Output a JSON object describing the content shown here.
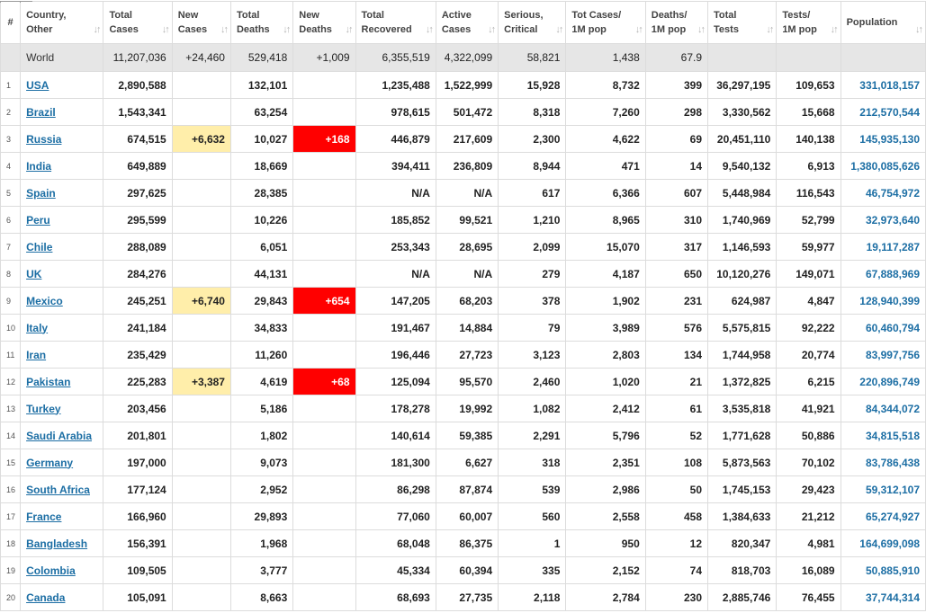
{
  "headers": [
    {
      "label": "#",
      "sort": false
    },
    {
      "label": "Country,\nOther",
      "sort": true
    },
    {
      "label": "Total\nCases",
      "sort": true
    },
    {
      "label": "New\nCases",
      "sort": true
    },
    {
      "label": "Total\nDeaths",
      "sort": true
    },
    {
      "label": "New\nDeaths",
      "sort": true
    },
    {
      "label": "Total\nRecovered",
      "sort": true
    },
    {
      "label": "Active\nCases",
      "sort": true
    },
    {
      "label": "Serious,\nCritical",
      "sort": true
    },
    {
      "label": "Tot Cases/\n1M pop",
      "sort": true
    },
    {
      "label": "Deaths/\n1M pop",
      "sort": true
    },
    {
      "label": "Total\nTests",
      "sort": true
    },
    {
      "label": "Tests/\n1M pop",
      "sort": true
    },
    {
      "label": "Population",
      "sort": true
    }
  ],
  "sort_icon": "↓↑",
  "sort_icon_active": "↓↑",
  "world": {
    "country": "World",
    "total_cases": "11,207,036",
    "new_cases": "+24,460",
    "total_deaths": "529,418",
    "new_deaths": "+1,009",
    "total_recovered": "6,355,519",
    "active_cases": "4,322,099",
    "serious": "58,821",
    "cases_1m": "1,438",
    "deaths_1m": "67.9",
    "total_tests": "",
    "tests_1m": "",
    "population": ""
  },
  "rows": [
    {
      "idx": "1",
      "country": "USA",
      "total_cases": "2,890,588",
      "new_cases": "",
      "total_deaths": "132,101",
      "new_deaths": "",
      "total_recovered": "1,235,488",
      "active_cases": "1,522,999",
      "serious": "15,928",
      "cases_1m": "8,732",
      "deaths_1m": "399",
      "total_tests": "36,297,195",
      "tests_1m": "109,653",
      "population": "331,018,157"
    },
    {
      "idx": "2",
      "country": "Brazil",
      "total_cases": "1,543,341",
      "new_cases": "",
      "total_deaths": "63,254",
      "new_deaths": "",
      "total_recovered": "978,615",
      "active_cases": "501,472",
      "serious": "8,318",
      "cases_1m": "7,260",
      "deaths_1m": "298",
      "total_tests": "3,330,562",
      "tests_1m": "15,668",
      "population": "212,570,544"
    },
    {
      "idx": "3",
      "country": "Russia",
      "total_cases": "674,515",
      "new_cases": "+6,632",
      "total_deaths": "10,027",
      "new_deaths": "+168",
      "total_recovered": "446,879",
      "active_cases": "217,609",
      "serious": "2,300",
      "cases_1m": "4,622",
      "deaths_1m": "69",
      "total_tests": "20,451,110",
      "tests_1m": "140,138",
      "population": "145,935,130"
    },
    {
      "idx": "4",
      "country": "India",
      "total_cases": "649,889",
      "new_cases": "",
      "total_deaths": "18,669",
      "new_deaths": "",
      "total_recovered": "394,411",
      "active_cases": "236,809",
      "serious": "8,944",
      "cases_1m": "471",
      "deaths_1m": "14",
      "total_tests": "9,540,132",
      "tests_1m": "6,913",
      "population": "1,380,085,626"
    },
    {
      "idx": "5",
      "country": "Spain",
      "total_cases": "297,625",
      "new_cases": "",
      "total_deaths": "28,385",
      "new_deaths": "",
      "total_recovered": "N/A",
      "active_cases": "N/A",
      "serious": "617",
      "cases_1m": "6,366",
      "deaths_1m": "607",
      "total_tests": "5,448,984",
      "tests_1m": "116,543",
      "population": "46,754,972"
    },
    {
      "idx": "6",
      "country": "Peru",
      "total_cases": "295,599",
      "new_cases": "",
      "total_deaths": "10,226",
      "new_deaths": "",
      "total_recovered": "185,852",
      "active_cases": "99,521",
      "serious": "1,210",
      "cases_1m": "8,965",
      "deaths_1m": "310",
      "total_tests": "1,740,969",
      "tests_1m": "52,799",
      "population": "32,973,640"
    },
    {
      "idx": "7",
      "country": "Chile",
      "total_cases": "288,089",
      "new_cases": "",
      "total_deaths": "6,051",
      "new_deaths": "",
      "total_recovered": "253,343",
      "active_cases": "28,695",
      "serious": "2,099",
      "cases_1m": "15,070",
      "deaths_1m": "317",
      "total_tests": "1,146,593",
      "tests_1m": "59,977",
      "population": "19,117,287"
    },
    {
      "idx": "8",
      "country": "UK",
      "total_cases": "284,276",
      "new_cases": "",
      "total_deaths": "44,131",
      "new_deaths": "",
      "total_recovered": "N/A",
      "active_cases": "N/A",
      "serious": "279",
      "cases_1m": "4,187",
      "deaths_1m": "650",
      "total_tests": "10,120,276",
      "tests_1m": "149,071",
      "population": "67,888,969"
    },
    {
      "idx": "9",
      "country": "Mexico",
      "total_cases": "245,251",
      "new_cases": "+6,740",
      "total_deaths": "29,843",
      "new_deaths": "+654",
      "total_recovered": "147,205",
      "active_cases": "68,203",
      "serious": "378",
      "cases_1m": "1,902",
      "deaths_1m": "231",
      "total_tests": "624,987",
      "tests_1m": "4,847",
      "population": "128,940,399"
    },
    {
      "idx": "10",
      "country": "Italy",
      "total_cases": "241,184",
      "new_cases": "",
      "total_deaths": "34,833",
      "new_deaths": "",
      "total_recovered": "191,467",
      "active_cases": "14,884",
      "serious": "79",
      "cases_1m": "3,989",
      "deaths_1m": "576",
      "total_tests": "5,575,815",
      "tests_1m": "92,222",
      "population": "60,460,794"
    },
    {
      "idx": "11",
      "country": "Iran",
      "total_cases": "235,429",
      "new_cases": "",
      "total_deaths": "11,260",
      "new_deaths": "",
      "total_recovered": "196,446",
      "active_cases": "27,723",
      "serious": "3,123",
      "cases_1m": "2,803",
      "deaths_1m": "134",
      "total_tests": "1,744,958",
      "tests_1m": "20,774",
      "population": "83,997,756"
    },
    {
      "idx": "12",
      "country": "Pakistan",
      "total_cases": "225,283",
      "new_cases": "+3,387",
      "total_deaths": "4,619",
      "new_deaths": "+68",
      "total_recovered": "125,094",
      "active_cases": "95,570",
      "serious": "2,460",
      "cases_1m": "1,020",
      "deaths_1m": "21",
      "total_tests": "1,372,825",
      "tests_1m": "6,215",
      "population": "220,896,749"
    },
    {
      "idx": "13",
      "country": "Turkey",
      "total_cases": "203,456",
      "new_cases": "",
      "total_deaths": "5,186",
      "new_deaths": "",
      "total_recovered": "178,278",
      "active_cases": "19,992",
      "serious": "1,082",
      "cases_1m": "2,412",
      "deaths_1m": "61",
      "total_tests": "3,535,818",
      "tests_1m": "41,921",
      "population": "84,344,072"
    },
    {
      "idx": "14",
      "country": "Saudi Arabia",
      "total_cases": "201,801",
      "new_cases": "",
      "total_deaths": "1,802",
      "new_deaths": "",
      "total_recovered": "140,614",
      "active_cases": "59,385",
      "serious": "2,291",
      "cases_1m": "5,796",
      "deaths_1m": "52",
      "total_tests": "1,771,628",
      "tests_1m": "50,886",
      "population": "34,815,518"
    },
    {
      "idx": "15",
      "country": "Germany",
      "total_cases": "197,000",
      "new_cases": "",
      "total_deaths": "9,073",
      "new_deaths": "",
      "total_recovered": "181,300",
      "active_cases": "6,627",
      "serious": "318",
      "cases_1m": "2,351",
      "deaths_1m": "108",
      "total_tests": "5,873,563",
      "tests_1m": "70,102",
      "population": "83,786,438"
    },
    {
      "idx": "16",
      "country": "South Africa",
      "total_cases": "177,124",
      "new_cases": "",
      "total_deaths": "2,952",
      "new_deaths": "",
      "total_recovered": "86,298",
      "active_cases": "87,874",
      "serious": "539",
      "cases_1m": "2,986",
      "deaths_1m": "50",
      "total_tests": "1,745,153",
      "tests_1m": "29,423",
      "population": "59,312,107"
    },
    {
      "idx": "17",
      "country": "France",
      "total_cases": "166,960",
      "new_cases": "",
      "total_deaths": "29,893",
      "new_deaths": "",
      "total_recovered": "77,060",
      "active_cases": "60,007",
      "serious": "560",
      "cases_1m": "2,558",
      "deaths_1m": "458",
      "total_tests": "1,384,633",
      "tests_1m": "21,212",
      "population": "65,274,927"
    },
    {
      "idx": "18",
      "country": "Bangladesh",
      "total_cases": "156,391",
      "new_cases": "",
      "total_deaths": "1,968",
      "new_deaths": "",
      "total_recovered": "68,048",
      "active_cases": "86,375",
      "serious": "1",
      "cases_1m": "950",
      "deaths_1m": "12",
      "total_tests": "820,347",
      "tests_1m": "4,981",
      "population": "164,699,098"
    },
    {
      "idx": "19",
      "country": "Colombia",
      "total_cases": "109,505",
      "new_cases": "",
      "total_deaths": "3,777",
      "new_deaths": "",
      "total_recovered": "45,334",
      "active_cases": "60,394",
      "serious": "335",
      "cases_1m": "2,152",
      "deaths_1m": "74",
      "total_tests": "818,703",
      "tests_1m": "16,089",
      "population": "50,885,910"
    },
    {
      "idx": "20",
      "country": "Canada",
      "total_cases": "105,091",
      "new_cases": "",
      "total_deaths": "8,663",
      "new_deaths": "",
      "total_recovered": "68,693",
      "active_cases": "27,735",
      "serious": "2,118",
      "cases_1m": "2,784",
      "deaths_1m": "230",
      "total_tests": "2,885,746",
      "tests_1m": "76,455",
      "population": "37,744,314"
    }
  ],
  "colors": {
    "link": "#1c6ea4",
    "new_cases_highlight": "#ffeeaa",
    "new_deaths_highlight": "#ff0000",
    "world_row_bg": "#e6e6e6"
  }
}
